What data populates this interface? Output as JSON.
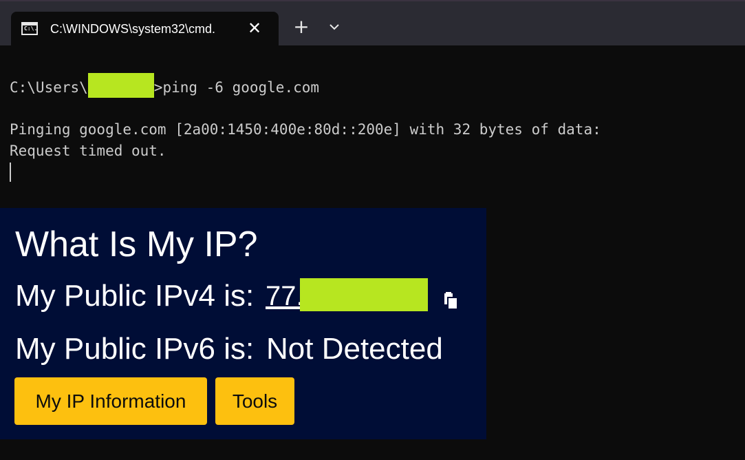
{
  "window": {
    "tab_title": "C:\\WINDOWS\\system32\\cmd.",
    "tab_icon": "cmd-icon",
    "tab_icon_text": "C:\\.",
    "close_glyph": "✕",
    "new_tab_glyph": "+",
    "dropdown_icon": "chevron-down-icon"
  },
  "terminal": {
    "prompt_prefix": "C:\\Users\\",
    "prompt_suffix": ">ping -6 google.com",
    "line2": "Pinging google.com [2a00:1450:400e:80d::200e] with 32 bytes of data:",
    "line3": "Request timed out."
  },
  "ipcard": {
    "title": "What Is My IP?",
    "ipv4_label": "My Public IPv4 is:",
    "ipv4_value_prefix": "77.",
    "ipv6_label": "My Public IPv6 is:",
    "ipv6_value": "Not Detected",
    "buttons": [
      "My IP Information",
      "Tools"
    ],
    "copy_icon": "copy-icon"
  },
  "colors": {
    "terminal_bg": "#0c0c0c",
    "tabstrip_bg": "#2b2b33",
    "card_bg": "#000d36",
    "button_bg": "#fdc00f",
    "redaction": "#b7e620"
  }
}
